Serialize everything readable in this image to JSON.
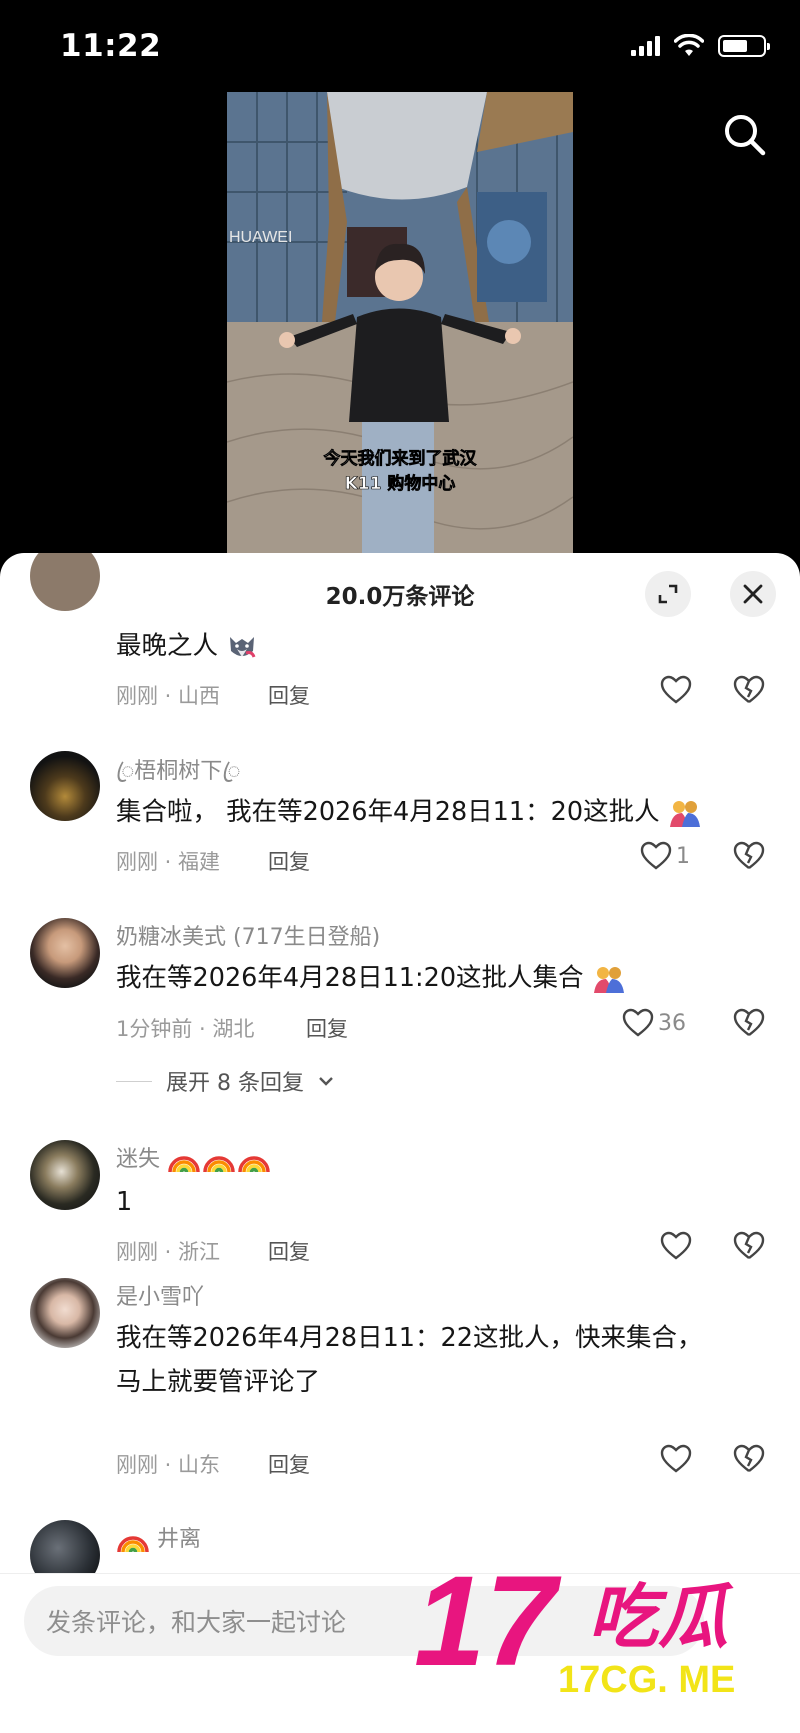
{
  "status": {
    "time": "11:22"
  },
  "video": {
    "caption_line1": "今天我们来到了武汉",
    "caption_line2": "K11 购物中心",
    "sign_text": "HUAWEI"
  },
  "sheet": {
    "title": "20.0万条评论"
  },
  "comments": [
    {
      "username": "",
      "text": "最晚之人",
      "time_location": "刚刚 · 山西",
      "reply": "回复",
      "likes": ""
    },
    {
      "username": "ꦿ梧桐树下ꦿ",
      "text": "集合啦， 我在等2026年4月28日11：20这批人",
      "time_location": "刚刚 · 福建",
      "reply": "回复",
      "likes": "1"
    },
    {
      "username": "奶糖冰美式 (717生日登船)",
      "text": "我在等2026年4月28日11:20这批人集合",
      "time_location": "1分钟前 · 湖北",
      "reply": "回复",
      "likes": "36",
      "expand": "展开 8 条回复"
    },
    {
      "username": "迷失",
      "text": "1",
      "time_location": "刚刚 · 浙江",
      "reply": "回复",
      "likes": ""
    },
    {
      "username": "是小雪吖",
      "text": "我在等2026年4月28日11：22这批人，快来集合，",
      "text_line2": "马上就要管评论了",
      "time_location": "刚刚 · 山东",
      "reply": "回复",
      "likes": ""
    },
    {
      "username": "井离",
      "text": ""
    }
  ],
  "input": {
    "placeholder": "发条评论，和大家一起讨论"
  },
  "watermark": {
    "logo": "17吃瓜",
    "site": "17CG. ME"
  },
  "colors": {
    "watermark_pink": "#e8157f",
    "background": "#000000",
    "sheet": "#ffffff"
  }
}
